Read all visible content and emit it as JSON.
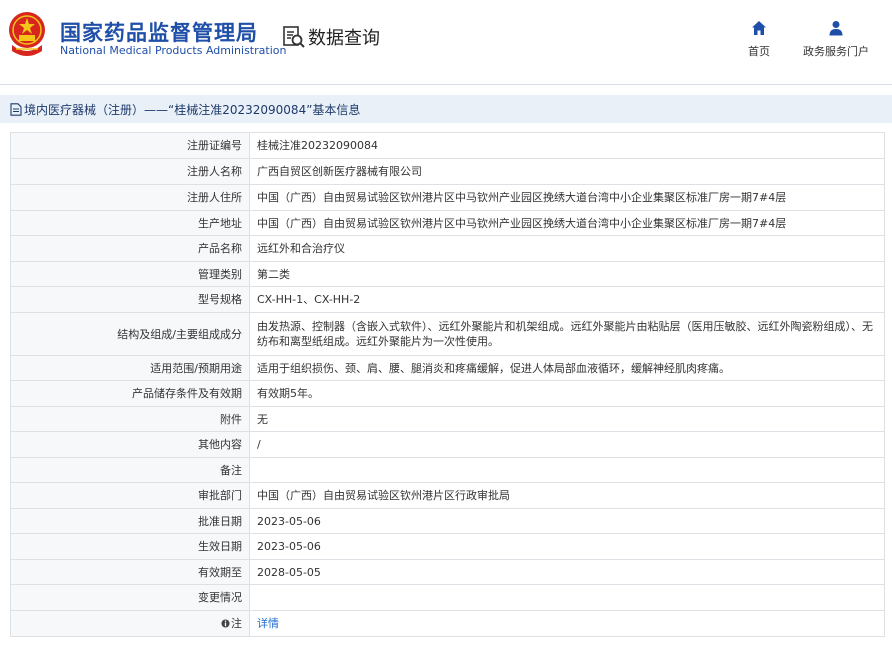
{
  "header": {
    "brand_cn": "国家药品监督管理局",
    "brand_en": "National Medical Products Administration",
    "query_title": "数据查询",
    "nav": [
      {
        "label": "首页",
        "icon": "home-icon"
      },
      {
        "label": "政务服务门户",
        "icon": "user-icon"
      }
    ]
  },
  "breadcrumb": {
    "text": "境内医疗器械（注册）——“桂械注准20232090084”基本信息",
    "icon": "document-icon"
  },
  "colors": {
    "brand": "#1f4fa8",
    "crumb_bg": "#e9f0f8",
    "link": "#1e6bd0",
    "label_bg": "#f7f8fa",
    "border": "#dde1e6"
  },
  "rows": [
    {
      "label": "注册证编号",
      "value": "桂械注准20232090084"
    },
    {
      "label": "注册人名称",
      "value": "广西自贸区创新医疗器械有限公司"
    },
    {
      "label": "注册人住所",
      "value": "中国（广西）自由贸易试验区钦州港片区中马钦州产业园区挽绣大道台湾中小企业集聚区标准厂房一期7#4层"
    },
    {
      "label": "生产地址",
      "value": "中国（广西）自由贸易试验区钦州港片区中马钦州产业园区挽绣大道台湾中小企业集聚区标准厂房一期7#4层"
    },
    {
      "label": "产品名称",
      "value": "远红外和合治疗仪"
    },
    {
      "label": "管理类别",
      "value": "第二类"
    },
    {
      "label": "型号规格",
      "value": "CX-HH-1、CX-HH-2"
    },
    {
      "label": "结构及组成/主要组成成分",
      "value": "由发热源、控制器（含嵌入式软件）、远红外聚能片和机架组成。远红外聚能片由粘贴层（医用压敏胶、远红外陶瓷粉组成）、无纺布和离型纸组成。远红外聚能片为一次性使用。"
    },
    {
      "label": "适用范围/预期用途",
      "value": "适用于组织损伤、颈、肩、腰、腿消炎和疼痛缓解，促进人体局部血液循环，缓解神经肌肉疼痛。"
    },
    {
      "label": "产品储存条件及有效期",
      "value": "有效期5年。"
    },
    {
      "label": "附件",
      "value": "无"
    },
    {
      "label": "其他内容",
      "value": "/"
    },
    {
      "label": "备注",
      "value": ""
    },
    {
      "label": "审批部门",
      "value": "中国（广西）自由贸易试验区钦州港片区行政审批局"
    },
    {
      "label": "批准日期",
      "value": "2023-05-06"
    },
    {
      "label": "生效日期",
      "value": "2023-05-06"
    },
    {
      "label": "有效期至",
      "value": "2028-05-05"
    },
    {
      "label": "变更情况",
      "value": ""
    },
    {
      "label": "注",
      "value": "详情",
      "link": true,
      "label_icon": "info-icon"
    }
  ]
}
